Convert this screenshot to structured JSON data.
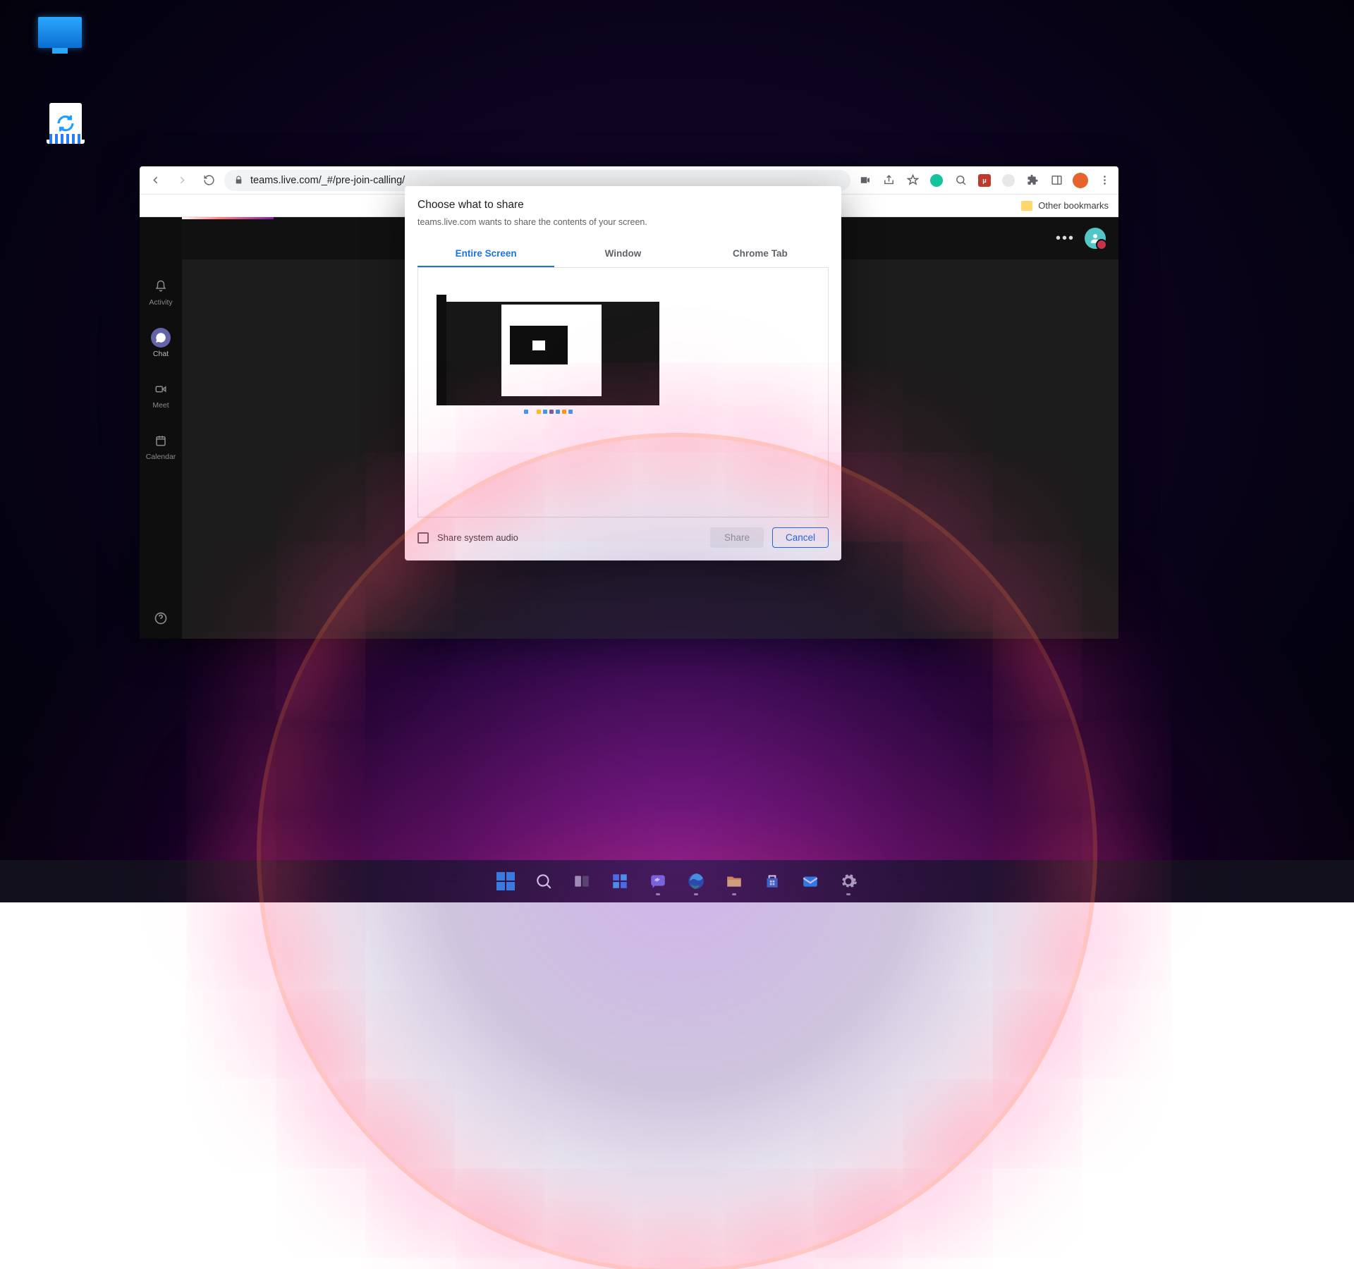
{
  "browser": {
    "url": "teams.live.com/_#/pre-join-calling/",
    "bookmarks_folder": "Other bookmarks"
  },
  "teams": {
    "rail": {
      "activity": "Activity",
      "chat": "Chat",
      "meet": "Meet",
      "calendar": "Calendar"
    }
  },
  "dialog": {
    "title": "Choose what to share",
    "subtitle": "teams.live.com wants to share the contents of your screen.",
    "tabs": {
      "entire": "Entire Screen",
      "window": "Window",
      "tab": "Chrome Tab"
    },
    "share_audio": "Share system audio",
    "share_btn": "Share",
    "cancel_btn": "Cancel"
  }
}
